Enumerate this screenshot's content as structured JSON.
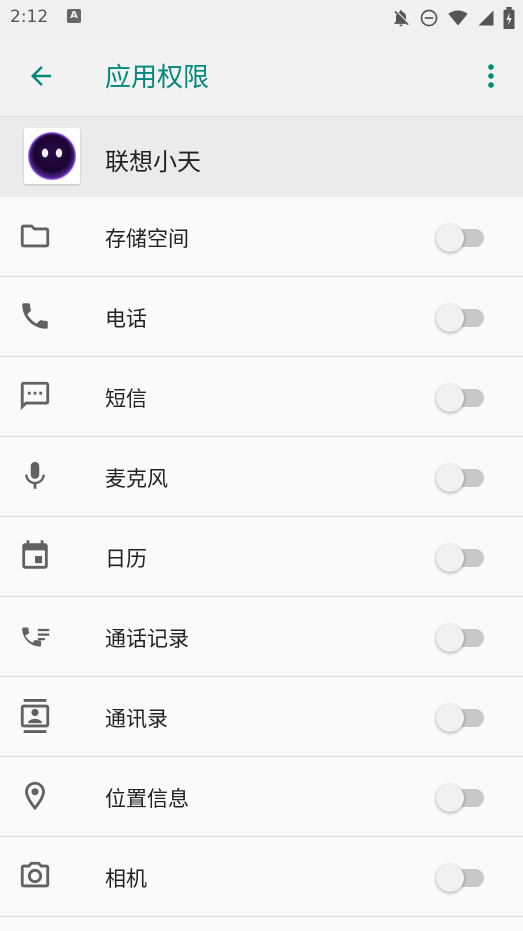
{
  "status_bar": {
    "time": "2:12",
    "notification_icon": "A",
    "icons": [
      "notifications-off-icon",
      "do-not-disturb-icon",
      "wifi-icon",
      "cellular-icon",
      "battery-icon"
    ]
  },
  "app_bar": {
    "title": "应用权限",
    "back_icon": "arrow-back-icon",
    "more_icon": "more-vert-icon"
  },
  "app": {
    "name": "联想小天",
    "icon": "app-icon"
  },
  "permissions": [
    {
      "label": "存储空间",
      "icon": "folder-icon",
      "enabled": false
    },
    {
      "label": "电话",
      "icon": "phone-icon",
      "enabled": false
    },
    {
      "label": "短信",
      "icon": "sms-icon",
      "enabled": false
    },
    {
      "label": "麦克风",
      "icon": "microphone-icon",
      "enabled": false
    },
    {
      "label": "日历",
      "icon": "calendar-icon",
      "enabled": false
    },
    {
      "label": "通话记录",
      "icon": "call-log-icon",
      "enabled": false
    },
    {
      "label": "通讯录",
      "icon": "contacts-icon",
      "enabled": false
    },
    {
      "label": "位置信息",
      "icon": "location-icon",
      "enabled": false
    },
    {
      "label": "相机",
      "icon": "camera-icon",
      "enabled": false
    }
  ],
  "colors": {
    "accent": "#00897b",
    "icon": "#616161",
    "switch_off_track": "#c8c8c8",
    "switch_off_thumb": "#f1f1f1"
  }
}
